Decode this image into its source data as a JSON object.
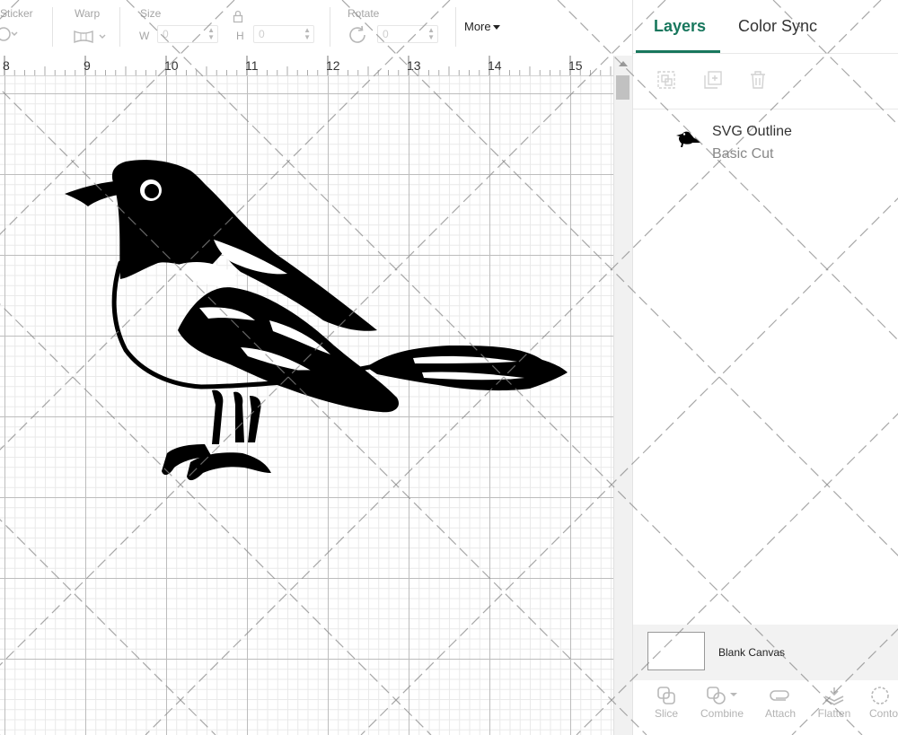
{
  "toolbar": {
    "sticker_label": "Sticker",
    "warp_label": "Warp",
    "size_label": "Size",
    "size_w_prefix": "W",
    "size_w_value": "0",
    "size_h_prefix": "H",
    "size_h_value": "0",
    "rotate_label": "Rotate",
    "rotate_value": "0",
    "more_label": "More"
  },
  "ruler": {
    "numbers": [
      "8",
      "9",
      "10",
      "11",
      "12",
      "13",
      "14",
      "15"
    ]
  },
  "panel": {
    "tabs": [
      {
        "label": "Layers",
        "active": true
      },
      {
        "label": "Color Sync",
        "active": false
      }
    ],
    "layer": {
      "name": "SVG Outline",
      "operation": "Basic Cut"
    },
    "blank_canvas_label": "Blank Canvas",
    "bottom_tools": [
      {
        "label": "Slice",
        "icon": "slice-icon"
      },
      {
        "label": "Combine",
        "icon": "combine-icon"
      },
      {
        "label": "Attach",
        "icon": "attach-icon"
      },
      {
        "label": "Flatten",
        "icon": "flatten-icon"
      },
      {
        "label": "Conto",
        "icon": "contour-icon"
      }
    ]
  },
  "colors": {
    "accent": "#18775d",
    "grid_major": "#bdbdbd",
    "grid_minor": "#e9e9e9",
    "bird": "#000000"
  }
}
